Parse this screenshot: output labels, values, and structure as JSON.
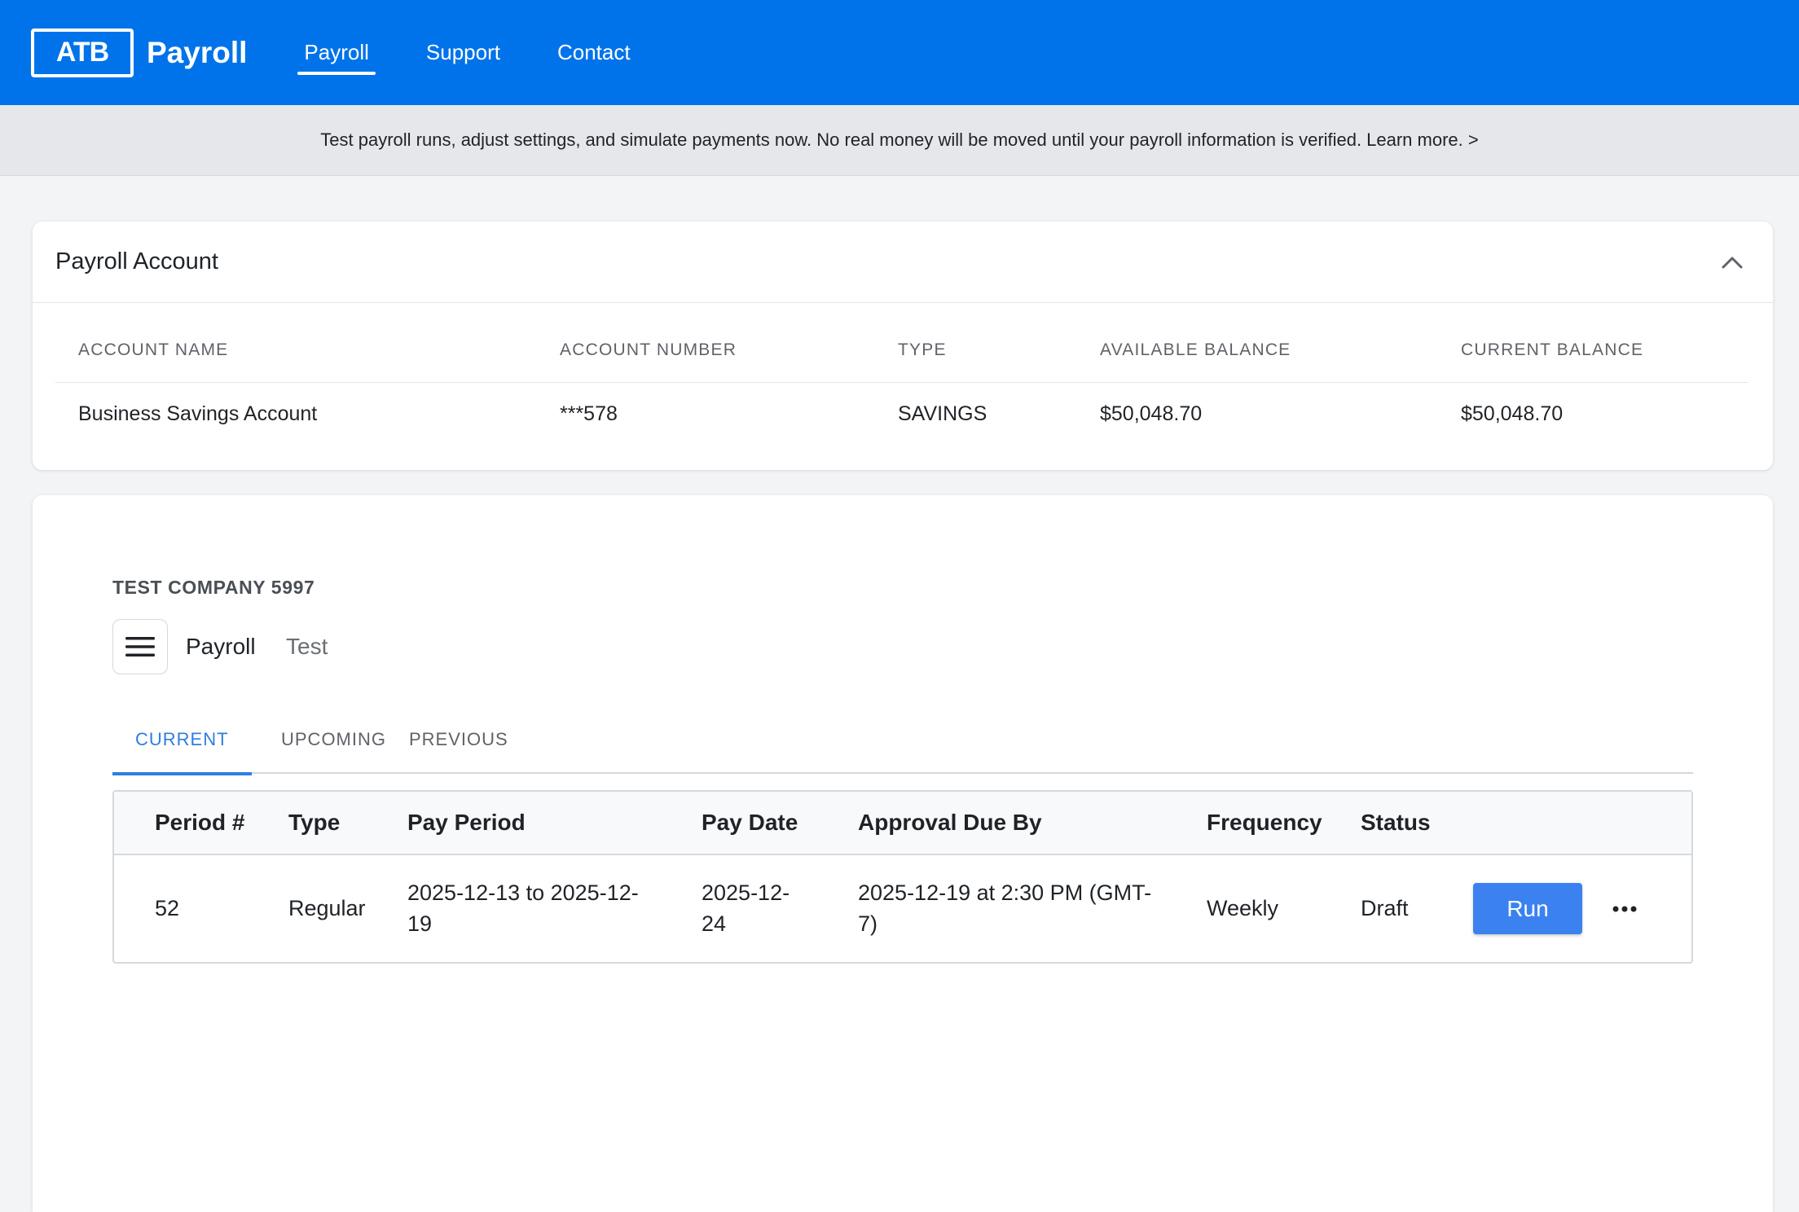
{
  "header": {
    "logo_text": "ATB",
    "brand_name": "Payroll",
    "nav": [
      {
        "label": "Payroll",
        "active": true
      },
      {
        "label": "Support",
        "active": false
      },
      {
        "label": "Contact",
        "active": false
      }
    ]
  },
  "banner": {
    "text": "Test payroll runs, adjust settings, and simulate payments now. No real money will be moved until your payroll information is verified.",
    "link": "Learn more. >"
  },
  "account": {
    "title": "Payroll Account",
    "collapse_icon": "chevron-up-icon",
    "columns": [
      "ACCOUNT NAME",
      "ACCOUNT NUMBER",
      "TYPE",
      "AVAILABLE BALANCE",
      "CURRENT BALANCE"
    ],
    "row": {
      "name": "Business Savings Account",
      "number": "***578",
      "type": "SAVINGS",
      "available": "$50,048.70",
      "current": "$50,048.70"
    }
  },
  "payroll": {
    "company": "TEST COMPANY 5997",
    "menu_icon": "hamburger-menu-icon",
    "breadcrumb": [
      "Payroll",
      "Test"
    ],
    "tabs": [
      {
        "label": "CURRENT",
        "active": true
      },
      {
        "label": "UPCOMING",
        "active": false
      },
      {
        "label": "PREVIOUS",
        "active": false
      }
    ],
    "columns": [
      "Period #",
      "Type",
      "Pay Period",
      "Pay Date",
      "Approval Due By",
      "Frequency",
      "Status"
    ],
    "rows": [
      {
        "period": "52",
        "type": "Regular",
        "pay_period_line1": "2025-12-13 to 2025-12-",
        "pay_period_line2": "19",
        "pay_date_line1": "2025-12-",
        "pay_date_line2": "24",
        "approval_line1": "2025-12-19 at 2:30 PM (GMT-",
        "approval_line2": "7)",
        "frequency": "Weekly",
        "status": "Draft",
        "action_label": "Run",
        "more_icon": "more-horizontal-icon"
      }
    ]
  },
  "colors": {
    "brand": "#0073ea",
    "accent": "#2f7de1",
    "button": "#3b82f0"
  }
}
